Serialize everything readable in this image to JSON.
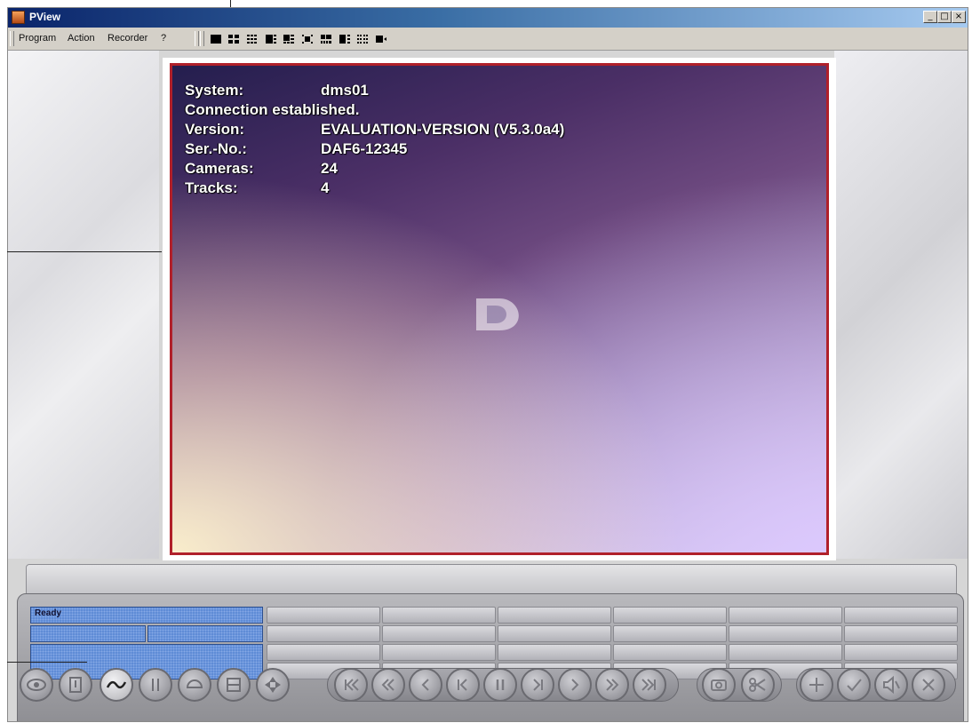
{
  "window": {
    "title": "PView",
    "min_label": "_",
    "max_label": "□",
    "close_label": "×"
  },
  "menu": {
    "items": [
      "Program",
      "Action",
      "Recorder",
      "?"
    ]
  },
  "layout_icons": [
    "layout-1x1-icon",
    "layout-2x2-icon",
    "layout-3x3-icon",
    "layout-1plus5-icon",
    "layout-1plus7-icon",
    "layout-center-icon",
    "layout-2plus8-icon",
    "layout-1plus12-icon",
    "layout-4x4-icon",
    "layout-fullscreen-icon"
  ],
  "video": {
    "system_label": "System:",
    "system_value": "dms01",
    "connection": "Connection established.",
    "version_label": "Version:",
    "version_value": "EVALUATION-VERSION (V5.3.0a4)",
    "serial_label": "Ser.-No.:",
    "serial_value": "DAF6-12345",
    "cameras_label": "Cameras:",
    "cameras_value": "24",
    "tracks_label": "Tracks:",
    "tracks_value": "4"
  },
  "status": {
    "text": "Ready"
  },
  "buttons": {
    "left_group": [
      "camera-icon",
      "alarm-icon",
      "link-icon",
      "info-icon",
      "dome-icon",
      "save-icon",
      "move-icon"
    ],
    "playback_group": [
      "first-frame-icon",
      "fast-rewind-icon",
      "rewind-icon",
      "step-back-icon",
      "pause-icon",
      "step-forward-icon",
      "play-icon",
      "fast-forward-icon",
      "last-frame-icon"
    ],
    "tool_group": [
      "snapshot-icon",
      "cut-icon"
    ],
    "right_group": [
      "zoom-in-icon",
      "check-icon",
      "mute-icon",
      "close-circle-icon"
    ]
  },
  "colors": {
    "frame_border": "#b0202a",
    "status_bg": "#5f8cd6",
    "title_bar": "#0a246a"
  }
}
